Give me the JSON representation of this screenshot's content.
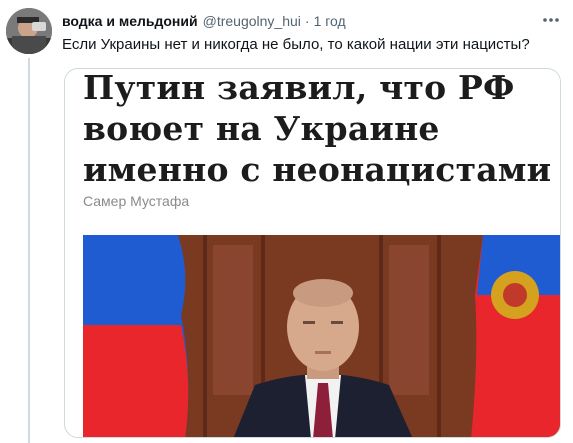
{
  "tweet": {
    "author_name": "водка и мельдоний",
    "author_handle": "@treugolny_hui",
    "separator": "·",
    "time": "1 год",
    "text": "Если Украины нет и никогда не было, то какой нации эти нацисты?",
    "more_icon": "more-horizontal-icon"
  },
  "card": {
    "headline": "Путин заявил, что РФ воюет на Украине именно с неонацистами",
    "author": "Самер Мустафа"
  },
  "colors": {
    "flag_white": "#ffffff",
    "flag_blue": "#1f5bd1",
    "flag_red": "#e8262b",
    "panel_wood": "#7a3a22",
    "handle_gray": "#536471"
  }
}
